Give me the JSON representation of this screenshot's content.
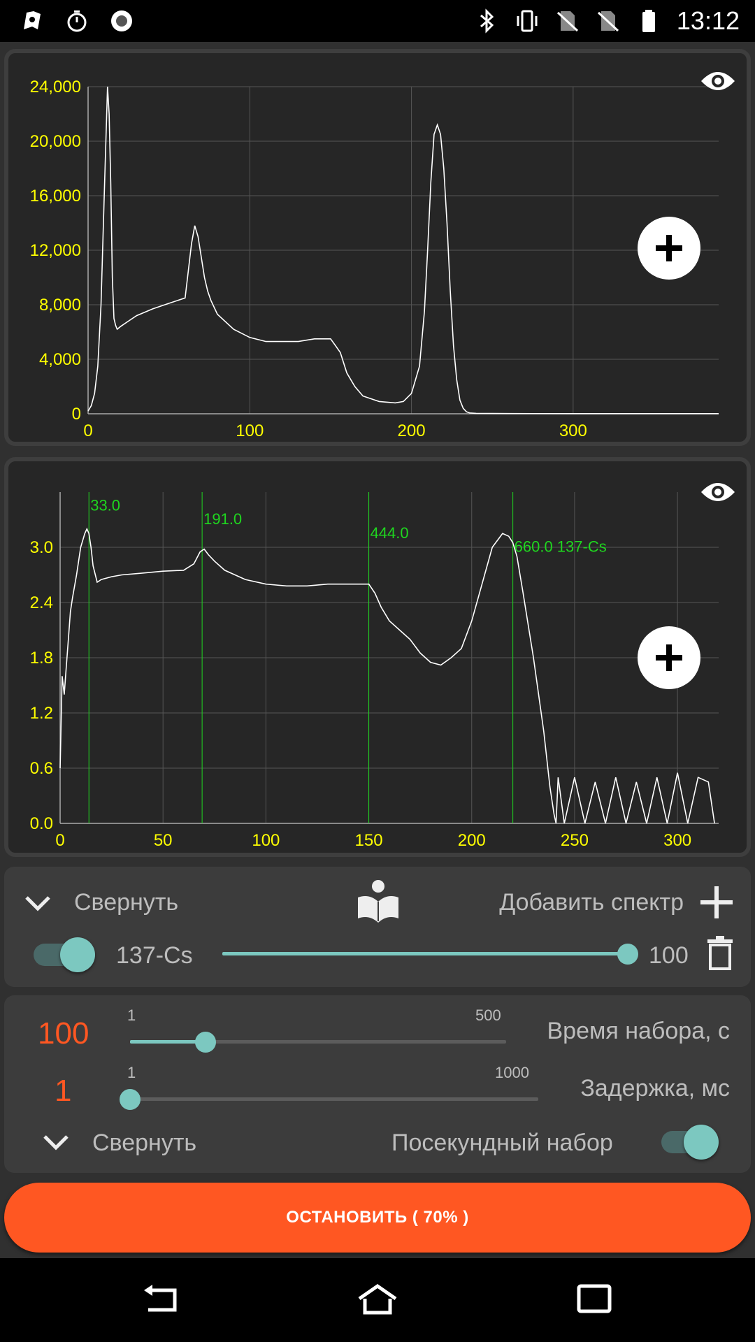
{
  "status_bar": {
    "time": "13:12",
    "left_icons": [
      "app-icon",
      "stopwatch-icon",
      "record-icon"
    ],
    "right_icons": [
      "bluetooth-icon",
      "vibrate-icon",
      "no-sim-icon",
      "no-sim-icon",
      "battery-icon"
    ]
  },
  "chart_data": [
    {
      "type": "line",
      "title": "",
      "xlabel": "",
      "ylabel": "",
      "xlim": [
        0,
        390
      ],
      "ylim": [
        0,
        24000
      ],
      "xticks": [
        0,
        100,
        200,
        300
      ],
      "yticks": [
        0,
        4000,
        8000,
        12000,
        16000,
        20000,
        24000
      ],
      "ytick_labels": [
        "0",
        "4,000",
        "8,000",
        "12,000",
        "16,000",
        "20,000",
        "24,000"
      ],
      "grid": true,
      "line_color": "#ffffff",
      "tick_color": "#ffff00",
      "x": [
        0,
        2,
        4,
        6,
        8,
        10,
        12,
        13,
        14,
        15,
        16,
        17,
        18,
        20,
        25,
        30,
        40,
        50,
        60,
        62,
        64,
        66,
        68,
        70,
        72,
        74,
        76,
        80,
        90,
        100,
        110,
        120,
        130,
        140,
        150,
        153,
        156,
        160,
        165,
        170,
        180,
        190,
        195,
        200,
        205,
        208,
        210,
        212,
        214,
        216,
        218,
        220,
        222,
        224,
        226,
        228,
        230,
        232,
        234,
        236,
        240,
        250,
        260,
        300,
        350,
        390
      ],
      "y": [
        200,
        600,
        1500,
        3500,
        8000,
        16000,
        24000,
        22000,
        17000,
        10000,
        7000,
        6500,
        6200,
        6400,
        6800,
        7200,
        7700,
        8100,
        8500,
        10500,
        12500,
        13800,
        13000,
        11500,
        10000,
        9000,
        8300,
        7300,
        6200,
        5600,
        5300,
        5300,
        5300,
        5500,
        5500,
        5000,
        4500,
        3000,
        2000,
        1300,
        900,
        800,
        900,
        1500,
        3500,
        7500,
        12000,
        17000,
        20500,
        21200,
        20500,
        18000,
        14000,
        9000,
        5000,
        2500,
        1000,
        400,
        150,
        60,
        30,
        20,
        15,
        12,
        10,
        10
      ]
    },
    {
      "type": "line",
      "title": "",
      "xlabel": "",
      "ylabel": "",
      "xlim": [
        0,
        320
      ],
      "ylim": [
        0,
        3.6
      ],
      "xticks": [
        0,
        50,
        100,
        150,
        200,
        250,
        300
      ],
      "yticks": [
        0.0,
        0.6,
        1.2,
        1.8,
        2.4,
        3.0
      ],
      "ytick_labels": [
        "0.0",
        "0.6",
        "1.2",
        "1.8",
        "2.4",
        "3.0"
      ],
      "grid": true,
      "line_color": "#ffffff",
      "tick_color": "#ffff00",
      "x": [
        0,
        1,
        2,
        3,
        4,
        5,
        6,
        8,
        10,
        12,
        13,
        14,
        15,
        16,
        18,
        20,
        25,
        30,
        40,
        50,
        60,
        65,
        68,
        70,
        72,
        75,
        80,
        90,
        100,
        110,
        120,
        130,
        140,
        150,
        153,
        156,
        160,
        165,
        170,
        175,
        180,
        185,
        190,
        195,
        200,
        205,
        210,
        215,
        218,
        220,
        222,
        225,
        230,
        235,
        238,
        240,
        241,
        242,
        245,
        250,
        255,
        260,
        265,
        270,
        275,
        280,
        285,
        290,
        295,
        300,
        305,
        310,
        315,
        318
      ],
      "y": [
        0.6,
        1.6,
        1.4,
        1.7,
        2.0,
        2.3,
        2.45,
        2.7,
        3.0,
        3.15,
        3.2,
        3.15,
        3.0,
        2.8,
        2.62,
        2.65,
        2.68,
        2.7,
        2.72,
        2.74,
        2.75,
        2.82,
        2.95,
        2.98,
        2.92,
        2.85,
        2.75,
        2.65,
        2.6,
        2.58,
        2.58,
        2.6,
        2.6,
        2.6,
        2.5,
        2.35,
        2.2,
        2.1,
        2.0,
        1.85,
        1.75,
        1.72,
        1.8,
        1.9,
        2.2,
        2.6,
        3.0,
        3.15,
        3.12,
        3.05,
        2.9,
        2.5,
        1.8,
        1.0,
        0.4,
        0.1,
        0.0,
        0.5,
        0.0,
        0.5,
        0.0,
        0.45,
        0.0,
        0.5,
        0.0,
        0.45,
        0.0,
        0.5,
        0.0,
        0.55,
        0.0,
        0.5,
        0.45,
        0.0
      ],
      "markers": [
        {
          "x": 14,
          "label": "33.0",
          "label_y": 3.4
        },
        {
          "x": 69,
          "label": "191.0",
          "label_y": 3.25
        },
        {
          "x": 150,
          "label": "444.0",
          "label_y": 3.1
        },
        {
          "x": 220,
          "label": "660.0  137-Cs",
          "label_y": 2.95
        }
      ],
      "marker_color": "#1fd61f"
    }
  ],
  "spectra_panel": {
    "collapse_label": "Свернуть",
    "add_spectrum_label": "Добавить спектр",
    "spectrum_name": "137-Cs",
    "spectrum_value": "100",
    "spectrum_level": 1.0,
    "spectrum_enabled": true
  },
  "acquisition_panel": {
    "time": {
      "value": "100",
      "min": "1",
      "max": "500",
      "label": "Время набора, с",
      "level": 0.2
    },
    "delay": {
      "value": "1",
      "min": "1",
      "max": "1000",
      "label": "Задержка, мс",
      "level": 0.0
    },
    "collapse_label": "Свернуть",
    "per_second_label": "Посекундный набор",
    "per_second_enabled": true
  },
  "stop_button": {
    "label": "ОСТАНОВИТЬ ( 70% )"
  },
  "colors": {
    "accent": "#ff5722",
    "teal": "#7cc8c0",
    "value_orange": "#ff5722"
  }
}
